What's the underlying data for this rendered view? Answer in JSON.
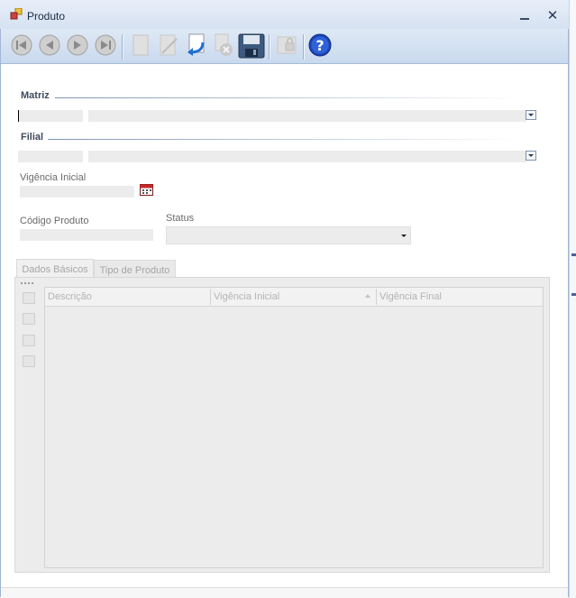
{
  "window": {
    "title": "Produto"
  },
  "toolbar": {
    "buttons": [
      {
        "name": "first-record",
        "icon": "first-icon",
        "enabled": false
      },
      {
        "name": "previous-record",
        "icon": "previous-icon",
        "enabled": false
      },
      {
        "name": "next-record",
        "icon": "next-icon",
        "enabled": false
      },
      {
        "name": "last-record",
        "icon": "last-icon",
        "enabled": false
      },
      {
        "name": "new",
        "icon": "new-document-icon",
        "enabled": false
      },
      {
        "name": "edit",
        "icon": "edit-icon",
        "enabled": false
      },
      {
        "name": "undo",
        "icon": "undo-arrow-icon",
        "enabled": true
      },
      {
        "name": "delete",
        "icon": "delete-icon",
        "enabled": false
      },
      {
        "name": "save",
        "icon": "save-disk-icon",
        "enabled": true
      },
      {
        "name": "print",
        "icon": "print-lock-icon",
        "enabled": false
      },
      {
        "name": "help",
        "icon": "help-icon",
        "enabled": true
      }
    ]
  },
  "form": {
    "matriz_label": "Matriz",
    "filial_label": "Filial",
    "vigencia_inicial_label": "Vigência Inicial",
    "codigo_produto_label": "Código Produto",
    "status_label": "Status"
  },
  "tabs": [
    {
      "label": "Dados Básicos",
      "active": true
    },
    {
      "label": "Tipo de Produto",
      "active": false
    }
  ],
  "grid": {
    "columns": [
      "Descrição",
      "Vigência Inicial",
      "Vigência Final"
    ],
    "sort_column": "Vigência Inicial",
    "rows": []
  },
  "colors": {
    "titlebar": "#dce6f4",
    "accent_blue": "#1f5fbf",
    "section_line": "#7d95b4"
  }
}
